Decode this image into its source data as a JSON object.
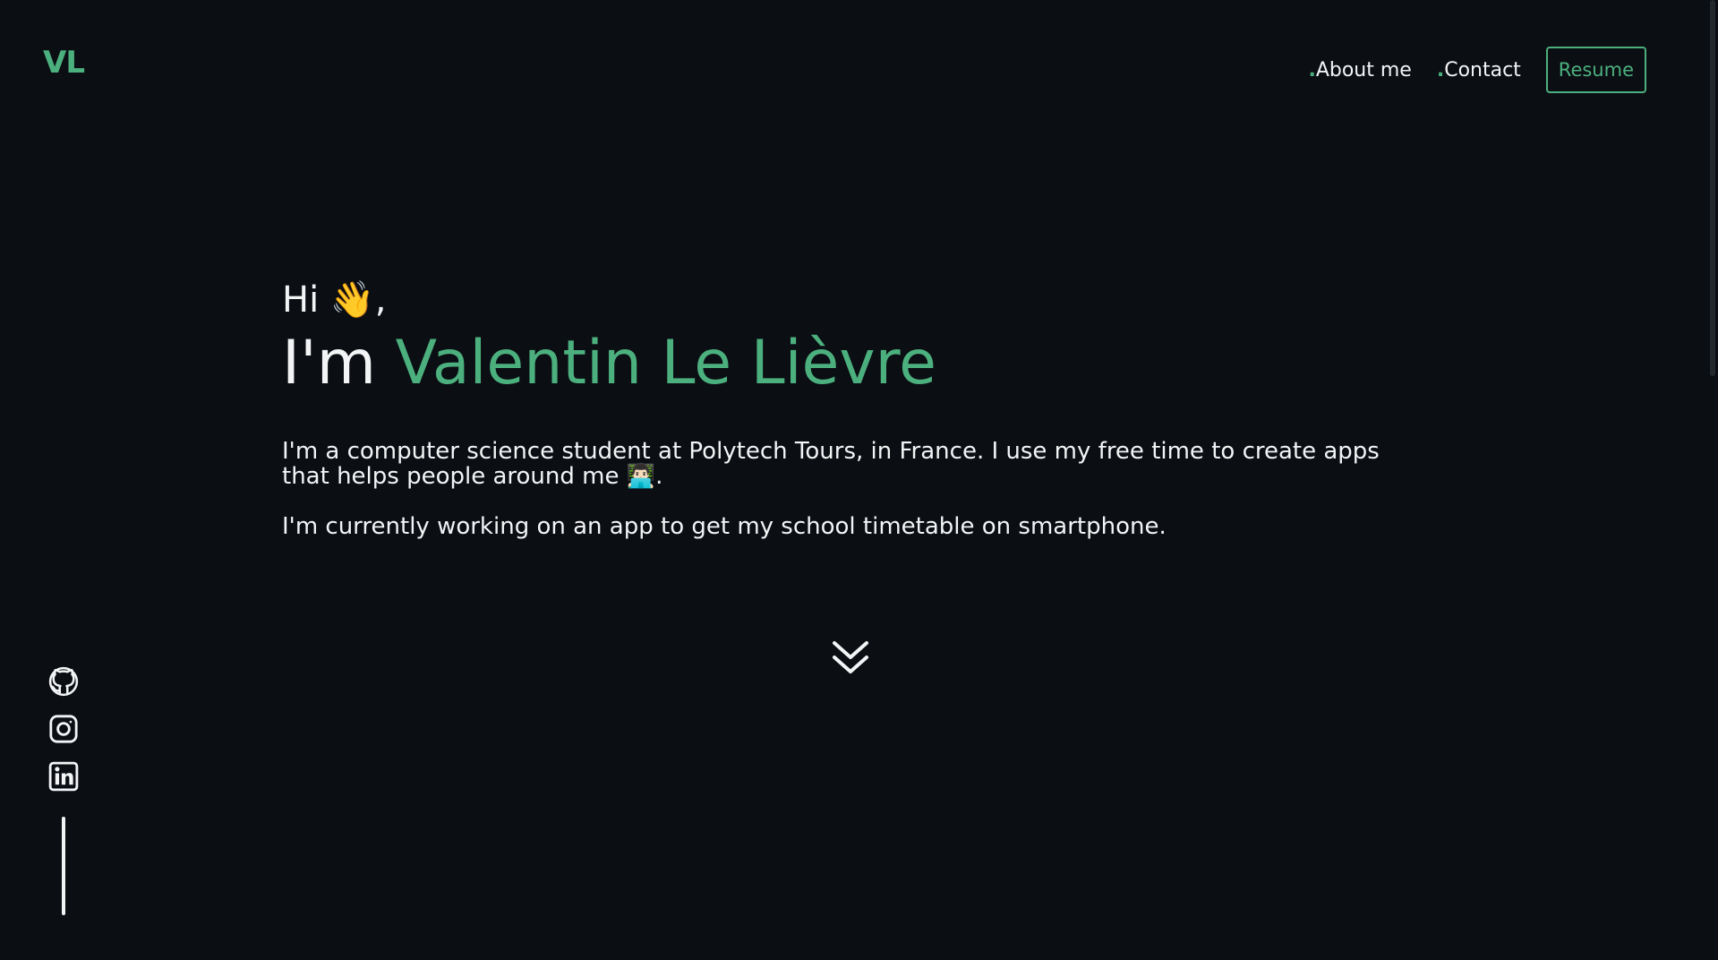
{
  "header": {
    "logo": "VL",
    "nav": [
      {
        "dot": ".",
        "label": "About me"
      },
      {
        "dot": ".",
        "label": "Contact"
      }
    ],
    "resume_label": "Resume"
  },
  "hero": {
    "greeting": "Hi 👋,",
    "im": "I'm ",
    "name": "Valentin Le Lièvre",
    "intro": "I'm a computer science student at Polytech Tours, in France. I use my free time to create apps that helps people around me 👨🏻‍💻.",
    "current": "I'm currently working on an app to get my school timetable on smartphone."
  },
  "social": [
    {
      "icon": "github-icon"
    },
    {
      "icon": "instagram-icon"
    },
    {
      "icon": "linkedin-icon"
    }
  ],
  "colors": {
    "background": "#0b0e13",
    "accent": "#4cb07e",
    "text": "#f3f4f6"
  }
}
